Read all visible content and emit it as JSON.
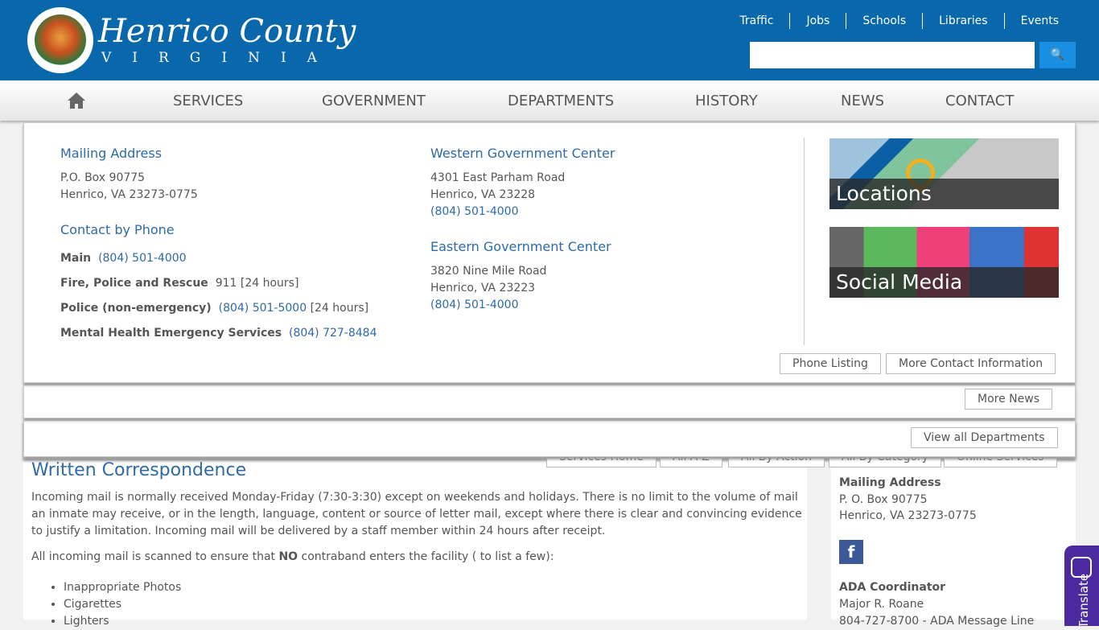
{
  "header": {
    "logo_title": "Henrico County",
    "logo_sub": "VIRGINIA",
    "top_links": [
      "Traffic",
      "Jobs",
      "Schools",
      "Libraries",
      "Events"
    ],
    "search_placeholder": ""
  },
  "nav": [
    "SERVICES",
    "GOVERNMENT",
    "DEPARTMENTS",
    "HISTORY",
    "NEWS",
    "CONTACT"
  ],
  "contact": {
    "mailing": {
      "title": "Mailing Address",
      "line1": "P.O. Box 90775",
      "line2": "Henrico, VA 23273-0775"
    },
    "phone": {
      "title": "Contact by Phone",
      "items": [
        {
          "label": "Main",
          "number": "(804) 501-4000",
          "note": ""
        },
        {
          "label": "Fire, Police and Rescue",
          "number": "911 [24 hours]",
          "note": ""
        },
        {
          "label": "Police (non-emergency)",
          "number": "(804) 501-5000",
          "note": "[24 hours]"
        },
        {
          "label": "Mental Health Emergency Services",
          "number": "(804) 727-8484",
          "note": ""
        }
      ]
    },
    "western": {
      "title": "Western Government Center",
      "line1": "4301 East Parham Road",
      "line2": "Henrico, VA 23228",
      "phone": "(804) 501-4000"
    },
    "eastern": {
      "title": "Eastern Government Center",
      "line1": "3820 Nine Mile Road",
      "line2": "Henrico, VA 23223",
      "phone": "(804) 501-4000"
    },
    "tiles": [
      "Locations",
      "Social Media"
    ],
    "buttons": [
      "Phone Listing",
      "More Contact Information"
    ]
  },
  "news_button": "More News",
  "departments_button": "View all Departments",
  "services_buttons": [
    "Services Home",
    "All A-Z",
    "All By Action",
    "All By Category",
    "Online Services"
  ],
  "main": {
    "heading": "Written Correspondence",
    "p1": "Incoming mail is normally received Monday-Friday (7:30-3:30) except on weekends and holidays. There is no limit to the volume of  mail an inmate may receive, or in the length, language, content or source of letter mail, except where there is clear and convincing evidence to justify a limitation. Incoming mail will be delivered by a staff member within 24 hours after receipt.",
    "p2a": "All incoming mail is scanned to ensure that ",
    "p2b": "NO",
    "p2c": " contraband enters the facility ( to list a few):",
    "list": [
      "Inappropriate Photos",
      "Cigarettes",
      "Lighters"
    ]
  },
  "side": {
    "title": "Mailing Address",
    "line1": "P. O. Box 90775",
    "line2": "Henrico, VA 23273-0775",
    "ada_title": "ADA Coordinator",
    "ada_name": "Major R. Roane",
    "ada_line": "804-727-8700 - ADA Message Line"
  },
  "translate_label": "Translate"
}
